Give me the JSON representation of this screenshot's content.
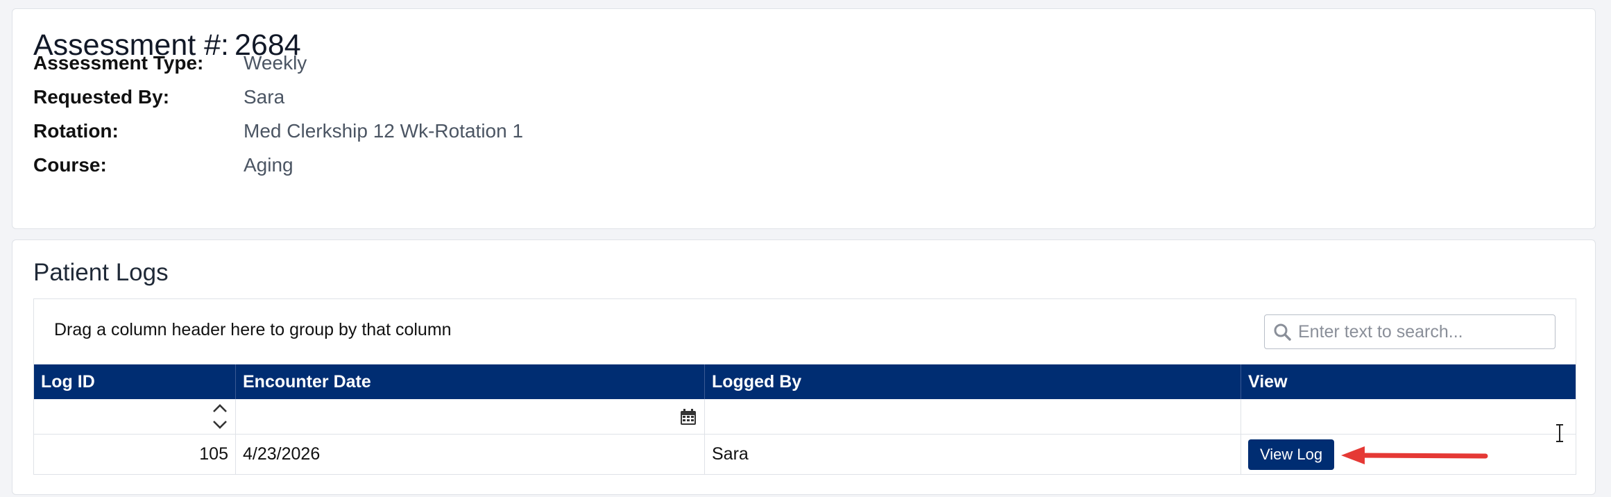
{
  "assessment": {
    "title_label": "Assessment #:",
    "number": "2684",
    "fields": [
      {
        "label": "Assessment Type:",
        "value": "Weekly"
      },
      {
        "label": "Requested By:",
        "value": "Sara"
      },
      {
        "label": "Rotation:",
        "value": "Med Clerkship 12 Wk-Rotation 1"
      },
      {
        "label": "Course:",
        "value": "Aging"
      }
    ]
  },
  "patient_logs": {
    "title": "Patient Logs",
    "group_panel_text": "Drag a column header here to group by that column",
    "search_placeholder": "Enter text to search...",
    "columns": [
      "Log ID",
      "Encounter Date",
      "Logged By",
      "View"
    ],
    "rows": [
      {
        "log_id": "105",
        "encounter_date": "4/23/2026",
        "logged_by": "Sara",
        "view_label": "View Log"
      }
    ]
  },
  "colors": {
    "header_bg": "#002d72",
    "button_bg": "#002d72",
    "arrow": "#e53935"
  },
  "icons": [
    "search-icon",
    "sort-spin-icon",
    "calendar-icon",
    "arrow-icon",
    "text-cursor-icon"
  ]
}
